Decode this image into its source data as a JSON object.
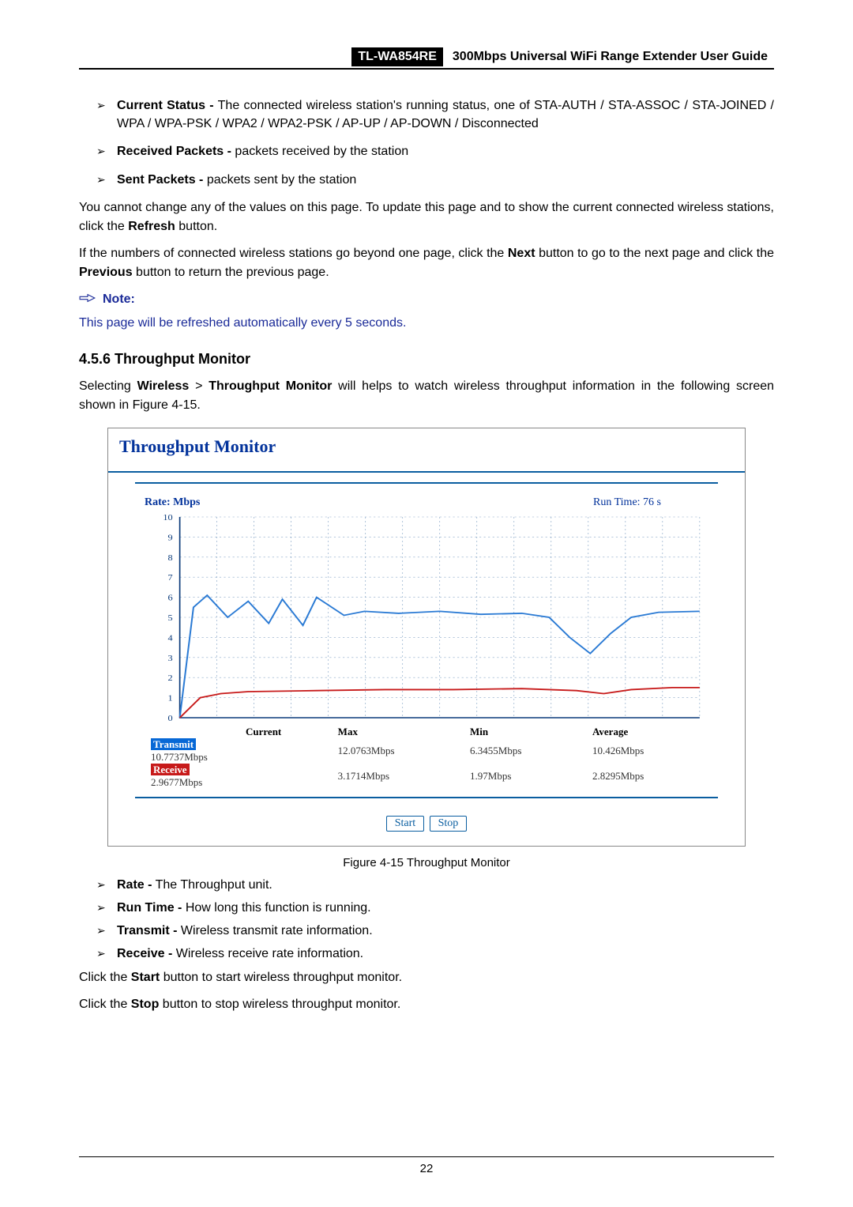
{
  "header": {
    "model": "TL-WA854RE",
    "title": "300Mbps Universal WiFi Range Extender User Guide"
  },
  "top_bullets": [
    {
      "label": "Current Status -",
      "desc": " The connected wireless station's running status, one of STA-AUTH / STA-ASSOC / STA-JOINED / WPA / WPA-PSK / WPA2 / WPA2-PSK / AP-UP / AP-DOWN / Disconnected"
    },
    {
      "label": "Received Packets -",
      "desc": " packets received by the station"
    },
    {
      "label": "Sent Packets -",
      "desc": " packets sent by the station"
    }
  ],
  "para1_a": "You cannot change any of the values on this page. To update this page and to show the current connected wireless stations, click the ",
  "para1_b": "Refresh",
  "para1_c": " button.",
  "para2_a": "If the numbers of connected wireless stations go beyond one page, click the ",
  "para2_b": "Next",
  "para2_c": " button to go to the next page and click the ",
  "para2_d": "Previous",
  "para2_e": " button to return the previous page.",
  "note_label": "Note:",
  "note_body": "This page will be refreshed automatically every 5 seconds.",
  "section_heading": "4.5.6  Throughput Monitor",
  "section_para_a": "Selecting ",
  "section_para_b": "Wireless",
  "section_para_c": " > ",
  "section_para_d": "Throughput Monitor",
  "section_para_e": " will helps to watch wireless throughput information in the following screen shown in Figure 4-15.",
  "figure": {
    "title": "Throughput Monitor",
    "rate_label": "Rate: Mbps",
    "runtime": "Run Time: 76 s",
    "headers": {
      "current": "Current",
      "max": "Max",
      "min": "Min",
      "avg": "Average"
    },
    "rows": {
      "transmit": {
        "name": "Transmit",
        "current": "10.7737Mbps",
        "max": "12.0763Mbps",
        "min": "6.3455Mbps",
        "avg": "10.426Mbps"
      },
      "receive": {
        "name": "Receive",
        "current": "2.9677Mbps",
        "max": "3.1714Mbps",
        "min": "1.97Mbps",
        "avg": "2.8295Mbps"
      }
    },
    "buttons": {
      "start": "Start",
      "stop": "Stop"
    }
  },
  "caption": "Figure 4-15 Throughput Monitor",
  "bottom_bullets": [
    {
      "label": "Rate -",
      "desc": " The Throughput unit."
    },
    {
      "label": "Run Time -",
      "desc": " How long this function is running."
    },
    {
      "label": "Transmit -",
      "desc": " Wireless transmit rate information."
    },
    {
      "label": "Receive -",
      "desc": " Wireless receive rate information."
    }
  ],
  "tail1_a": "Click the ",
  "tail1_b": "Start",
  "tail1_c": " button to start wireless throughput monitor.",
  "tail2_a": "Click the ",
  "tail2_b": "Stop",
  "tail2_c": " button to stop wireless throughput monitor.",
  "page_num": "22",
  "chart_data": {
    "type": "line",
    "title": "Throughput Monitor",
    "xlabel": "",
    "ylabel": "Rate: Mbps",
    "ylim": [
      0,
      10
    ],
    "y_ticks": [
      0,
      1,
      2,
      3,
      4,
      5,
      6,
      7,
      8,
      9,
      10
    ],
    "x_range": 76,
    "series": [
      {
        "name": "Transmit",
        "color": "#2a7ad4",
        "points": [
          [
            0,
            0
          ],
          [
            2,
            5.5
          ],
          [
            4,
            6.1
          ],
          [
            7,
            5.0
          ],
          [
            10,
            5.8
          ],
          [
            13,
            4.7
          ],
          [
            15,
            5.9
          ],
          [
            18,
            4.6
          ],
          [
            20,
            6.0
          ],
          [
            24,
            5.1
          ],
          [
            27,
            5.3
          ],
          [
            32,
            5.2
          ],
          [
            38,
            5.3
          ],
          [
            44,
            5.15
          ],
          [
            50,
            5.2
          ],
          [
            54,
            5.0
          ],
          [
            57,
            4.0
          ],
          [
            60,
            3.2
          ],
          [
            63,
            4.2
          ],
          [
            66,
            5.0
          ],
          [
            70,
            5.25
          ],
          [
            76,
            5.3
          ]
        ]
      },
      {
        "name": "Receive",
        "color": "#c71a1a",
        "points": [
          [
            0,
            0
          ],
          [
            3,
            1.0
          ],
          [
            6,
            1.2
          ],
          [
            10,
            1.3
          ],
          [
            20,
            1.35
          ],
          [
            30,
            1.4
          ],
          [
            40,
            1.4
          ],
          [
            50,
            1.45
          ],
          [
            58,
            1.35
          ],
          [
            62,
            1.2
          ],
          [
            66,
            1.4
          ],
          [
            72,
            1.5
          ],
          [
            76,
            1.5
          ]
        ]
      }
    ]
  }
}
